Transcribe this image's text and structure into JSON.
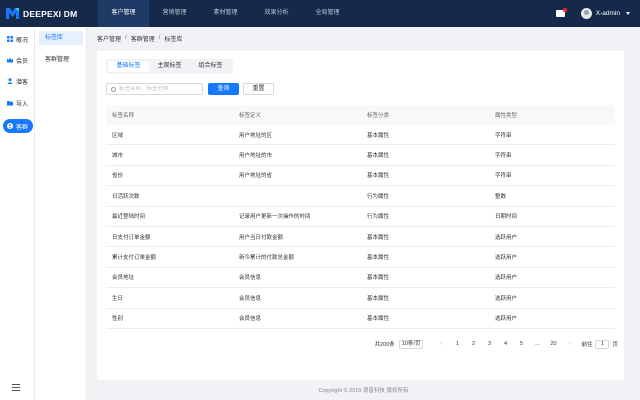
{
  "brand": {
    "name": "DEEPEXI DM"
  },
  "topnav": [
    {
      "label": "客户管理",
      "active": true
    },
    {
      "label": "营销管理",
      "active": false
    },
    {
      "label": "素材管理",
      "active": false
    },
    {
      "label": "效果分析",
      "active": false
    },
    {
      "label": "全局管理",
      "active": false
    }
  ],
  "user": {
    "name": "X-admin"
  },
  "sidebar": [
    {
      "label": "概况",
      "icon": "grid-icon",
      "active": false
    },
    {
      "label": "会员",
      "icon": "crown-icon",
      "active": false
    },
    {
      "label": "潜客",
      "icon": "user-icon",
      "active": false
    },
    {
      "label": "导入",
      "icon": "folder-icon",
      "active": false
    },
    {
      "label": "客群",
      "icon": "group-icon",
      "active": true
    }
  ],
  "subnav": [
    {
      "label": "标签库",
      "active": true
    },
    {
      "label": "客群管理",
      "active": false
    }
  ],
  "breadcrumb": [
    "客户管理",
    "客群管理",
    "标签库"
  ],
  "tabs": [
    {
      "label": "基础标签",
      "active": true
    },
    {
      "label": "主观标签",
      "active": false
    },
    {
      "label": "组合标签",
      "active": false
    }
  ],
  "search": {
    "placeholder": "标签名称、标签分类",
    "value": ""
  },
  "buttons": {
    "query": "查询",
    "reset": "重置"
  },
  "table": {
    "columns": [
      "标签名称",
      "标签定义",
      "标签分类",
      "属性类型"
    ],
    "rows": [
      [
        "区域",
        "用户地址的区",
        "基本属性",
        "字符串"
      ],
      [
        "城市",
        "用户地址的市",
        "基本属性",
        "字符串"
      ],
      [
        "省份",
        "用户地址的省",
        "基本属性",
        "字符串"
      ],
      [
        "日活跃次数",
        "",
        "行为属性",
        "整数"
      ],
      [
        "最近登陆时间",
        "记录用户更新一次操作的时间",
        "行为属性",
        "日期时间"
      ],
      [
        "日支付订单金额",
        "用户当日付款金额",
        "基本属性",
        "选跃用户"
      ],
      [
        "累计支付订单金额",
        "新今累计的付款总金额",
        "基本属性",
        "选跃用户"
      ],
      [
        "会员地址",
        "会员信息",
        "基本属性",
        "选跃用户"
      ],
      [
        "生日",
        "会员信息",
        "基本属性",
        "选跃用户"
      ],
      [
        "性别",
        "会员信息",
        "基本属性",
        "选跃用户"
      ]
    ]
  },
  "pagination": {
    "total": "共200条",
    "page_size": "10条/页",
    "pages": [
      "1",
      "2",
      "3",
      "4",
      "5",
      "...",
      "20"
    ],
    "prev": "‹",
    "next": "›",
    "goto_label": "前往",
    "goto_value": "1",
    "goto_suffix": "页"
  },
  "footer": "Copyright © 2019 滴普科技 版权所有",
  "colors": {
    "topbar": "#152a4a",
    "accent": "#1677ff"
  }
}
